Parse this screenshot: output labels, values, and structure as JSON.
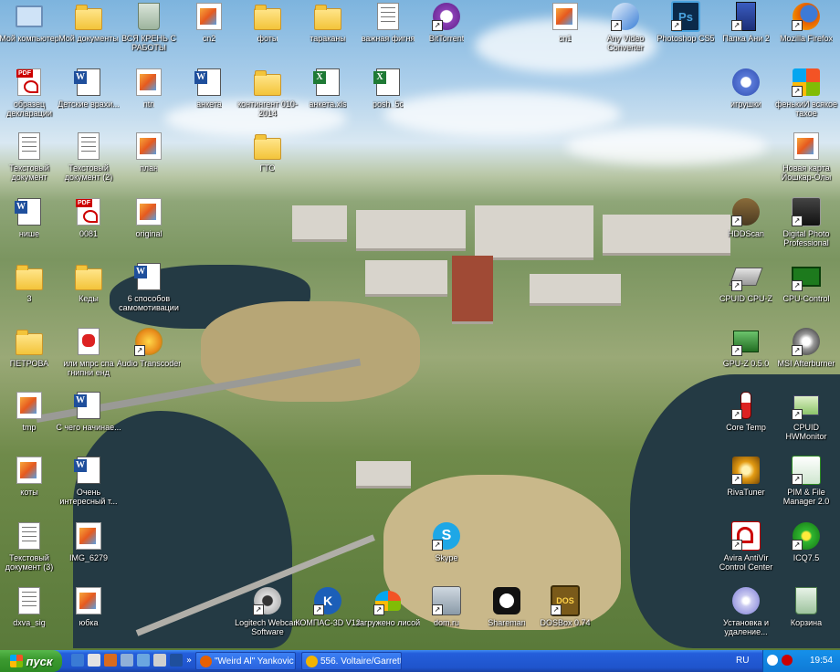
{
  "desktop": {
    "icons": {
      "my_computer": "Мой компьютер",
      "my_documents": "Мой документы",
      "recycle_bin": "ВСЯ КРЕНЬ С РАБОТЫ",
      "cn2": "cn2",
      "foto": "фоты",
      "tarakany": "тараканы",
      "vazhnaya": "важная фигня",
      "bittorrent": "BitTorrent",
      "cn1": "cn1",
      "any_video": "Any Video Converter",
      "photoshop": "Photoshop CS5",
      "papka_ani": "Папка Ани 2",
      "firefox": "Mozilla Firefox",
      "obrazec": "образец декларации",
      "detskie": "Детские врахи...",
      "ntn": "ntn",
      "anketa": "анкета",
      "kontingent": "контингент 010-2014",
      "anketa_xlsx": "анкета.xls",
      "posh": "posh_5c",
      "igrushki": "игрушки",
      "fenki": "фенькиИ всякое тахое",
      "text1": "Текстовый документ",
      "text2": "Текстовый документ (2)",
      "plan": "план",
      "gto": "ГТО",
      "karta": "Новая карта Йошкар-Олы",
      "nishe": "нише",
      "n0081": "0081",
      "original": "original",
      "hddscan": "HDDScan",
      "digital_photo": "Digital Photo Professional",
      "f3": "3",
      "kedy": "Кеды",
      "sposobov": "6 способов самомотивации",
      "cpuid_cpuz": "CPUID CPU-Z",
      "cpu_control": "CPU-Control",
      "petrova": "ПЕТРОВА",
      "ili": "или мпрс спа гнипни енд",
      "audio_transcoder": "Audio Transcoder",
      "gpuz": "GPU-Z 0.5.0",
      "msi": "MSI Afterburner",
      "tmp": "tmp",
      "s_chego": "С чего начинае...",
      "core_temp": "Core Temp",
      "cpuid_hw": "CPUID HWMonitor",
      "koty": "коты",
      "ochen": "Очень интересный т...",
      "rivatuner": "RivaTuner",
      "pim": "PIM & File Manager 2.0",
      "text3": "Текстовый документ (3)",
      "img6279": "IMG_6279",
      "skype": "Skype",
      "avira": "Avira AntiVir Control Center",
      "icq": "ICQ7.5",
      "dxva": "dxva_sig",
      "yubka": "юбка",
      "logitech": "Logitech Webcam Software",
      "kompas": "КОМПАС-3D V12",
      "zagruzheno": "загружено лисой",
      "domru": "dom.ru",
      "shareman": "Shareman",
      "dosbox": "DOSBox 0.74",
      "ustanovka": "Установка и удаление...",
      "korzina": "Корзина"
    }
  },
  "taskbar": {
    "start_label": "пуск",
    "tasks": [
      "\"Weird Al\" Yankovic - ...",
      "556. Voltaire/Garrett ..."
    ],
    "tray": {
      "lang": "RU",
      "time": "19:54"
    }
  },
  "colors": {
    "taskbar": "#245edb",
    "start": "#3c9a30",
    "tray": "#0f7ad6"
  }
}
